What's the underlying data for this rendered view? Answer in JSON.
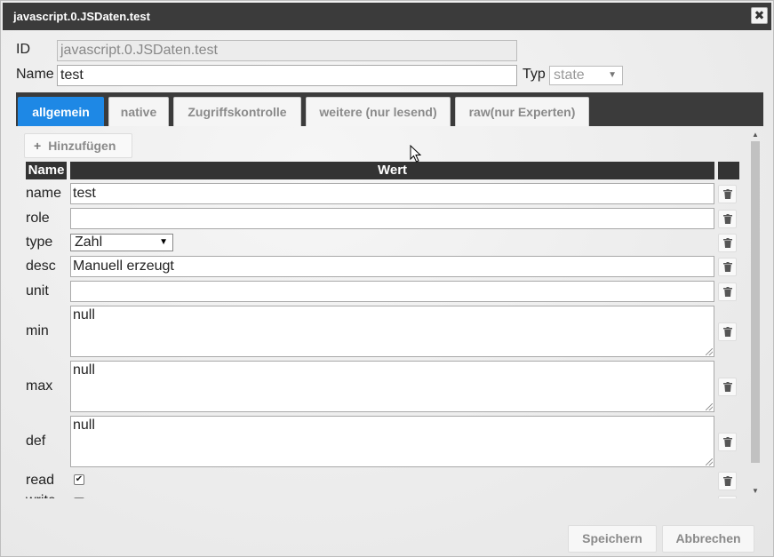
{
  "window": {
    "title": "javascript.0.JSDaten.test",
    "close_label": "✖"
  },
  "header": {
    "id_label": "ID",
    "id_value": "javascript.0.JSDaten.test",
    "name_label": "Name",
    "name_value": "test",
    "typ_label": "Typ",
    "typ_value": "state"
  },
  "tabs": [
    {
      "label": "allgemein",
      "active": true
    },
    {
      "label": "native"
    },
    {
      "label": "Zugriffskontrolle"
    },
    {
      "label": "weitere (nur lesend)"
    },
    {
      "label": "raw(nur Experten)"
    }
  ],
  "panel": {
    "add_label": "Hinzufügen",
    "columns": {
      "name": "Name",
      "value": "Wert"
    },
    "rows": {
      "name": {
        "label": "name",
        "value": "test"
      },
      "role": {
        "label": "role",
        "value": ""
      },
      "type": {
        "label": "type",
        "value": "Zahl"
      },
      "desc": {
        "label": "desc",
        "value": "Manuell erzeugt"
      },
      "unit": {
        "label": "unit",
        "value": ""
      },
      "min": {
        "label": "min",
        "value": "null"
      },
      "max": {
        "label": "max",
        "value": "null"
      },
      "def": {
        "label": "def",
        "value": "null"
      },
      "read": {
        "label": "read",
        "checked": true
      },
      "write": {
        "label": "write",
        "checked": false
      }
    }
  },
  "footer": {
    "save_label": "Speichern",
    "cancel_label": "Abbrechen"
  },
  "icons": {
    "delete": "trash-icon",
    "add": "plus-icon",
    "close": "close-icon"
  }
}
